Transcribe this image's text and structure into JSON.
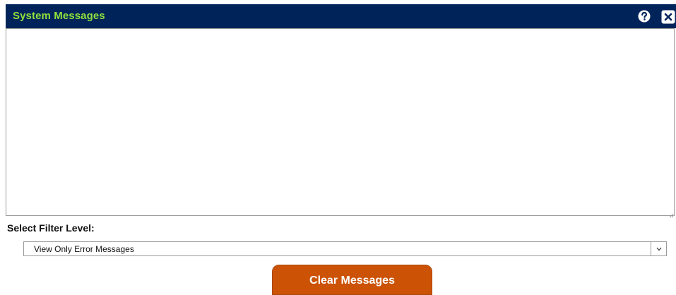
{
  "dialog": {
    "title": "System Messages",
    "help_icon": "help-icon",
    "close_icon": "close-icon"
  },
  "messages": {
    "content": ""
  },
  "filter": {
    "label": "Select Filter Level:",
    "selected_value": "View Only Error Messages",
    "arrow_icon": "chevron-down-icon"
  },
  "actions": {
    "clear_label": "Clear Messages"
  },
  "colors": {
    "titlebar_bg": "#00245a",
    "title_text": "#8fe03c",
    "clear_button_bg": "#cc5206"
  }
}
